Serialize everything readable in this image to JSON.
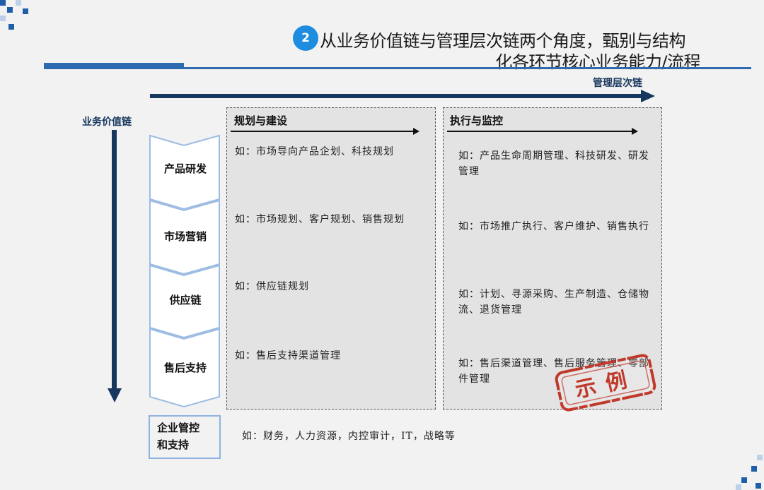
{
  "title": {
    "number": "2",
    "line1": "从业务价值链与管理层次链两个角度，甄别与结构",
    "line2": "化各环节核心业务能力/流程"
  },
  "axes": {
    "horizontal_label": "管理层次链",
    "vertical_label": "业务价值链"
  },
  "value_chain": [
    {
      "label": "产品研发"
    },
    {
      "label": "市场营销"
    },
    {
      "label": "供应链"
    },
    {
      "label": "售后支持"
    }
  ],
  "planning": {
    "title": "规划与建设",
    "items": [
      "如：市场导向产品企划、科技规划",
      "如：市场规划、客户规划、销售规划",
      "如：供应链规划",
      "如：售后支持渠道管理"
    ]
  },
  "execution": {
    "title": "执行与监控",
    "items": [
      "如：产品生命周期管理、科技研发、研发管理",
      "如：市场推广执行、客户维护、销售执行",
      "如：计划、寻源采购、生产制造、仓储物流、退货管理",
      "如：售后渠道管理、售后服务管理、零部件管理"
    ]
  },
  "enterprise": {
    "label_line1": "企业管控",
    "label_line2": "和支持",
    "text": "如：财务，人力资源，内控审计，IT，战略等"
  },
  "stamp": {
    "text": "示例",
    "color": "#c0392b"
  },
  "colors": {
    "accent": "#2e6ab0",
    "dark_navy": "#17375e",
    "circle": "#1e8de0",
    "chevron_border": "#9dbce3"
  }
}
